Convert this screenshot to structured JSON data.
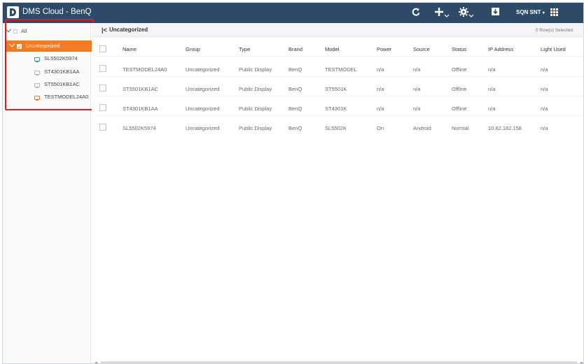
{
  "header": {
    "title": "DMS Cloud - BenQ",
    "icons": [
      "refresh-icon",
      "add-icon",
      "settings-icon",
      "download-icon",
      "apps-grid-icon"
    ],
    "user": "SQN SNT"
  },
  "sidebar": {
    "all_label": "All",
    "group_label": "Uncategorized",
    "devices": [
      {
        "name": "SL5502K5974",
        "status": "online"
      },
      {
        "name": "ST4301KB1AA",
        "status": "offline"
      },
      {
        "name": "ST5501KB1AC",
        "status": "offline"
      },
      {
        "name": "TESTMODEL24A0",
        "status": "warning"
      }
    ],
    "highlight_color": "#e21b1b",
    "accent_color": "#f47b20"
  },
  "main": {
    "breadcrumb": "Uncategorized",
    "rows_selected": "0 Row(s) Selected",
    "columns": [
      "Name",
      "Group",
      "Type",
      "Brand",
      "Model",
      "Power",
      "Source",
      "Status",
      "IP Address",
      "Light Used"
    ],
    "rows": [
      [
        "TESTMODEL24A0",
        "Uncategorized",
        "Public Display",
        "BenQ",
        "TESTMODEL",
        "n/a",
        "n/a",
        "Offline",
        "n/a",
        "n/a"
      ],
      [
        "ST5501KB1AC",
        "Uncategorized",
        "Public Display",
        "BenQ",
        "ST5501K",
        "n/a",
        "n/a",
        "Offline",
        "n/a",
        "n/a"
      ],
      [
        "ST4301KB1AA",
        "Uncategorized",
        "Public Display",
        "BenQ",
        "ST4301K",
        "n/a",
        "n/a",
        "Offline",
        "n/a",
        "n/a"
      ],
      [
        "SL5502K5974",
        "Uncategorized",
        "Public Display",
        "BenQ",
        "SL5502K",
        "On",
        "Android",
        "Normal",
        "10.82.182.158",
        "n/a"
      ]
    ]
  }
}
